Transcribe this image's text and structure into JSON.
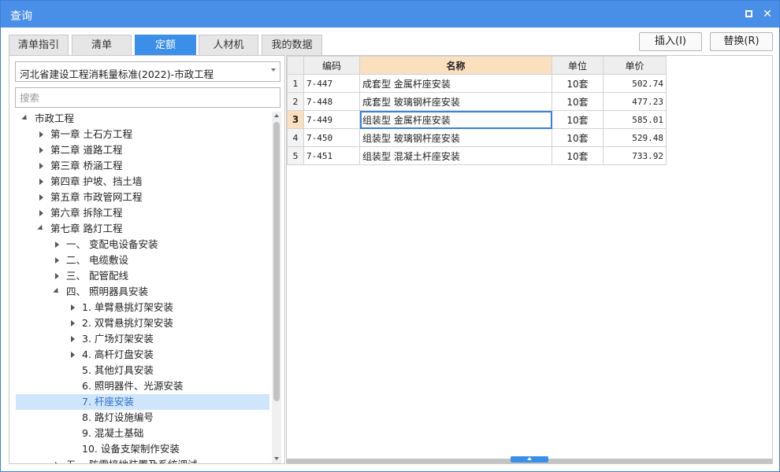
{
  "window": {
    "title": "查询"
  },
  "tabs": [
    {
      "label": "清单指引"
    },
    {
      "label": "清单"
    },
    {
      "label": "定额"
    },
    {
      "label": "人材机"
    },
    {
      "label": "我的数据"
    }
  ],
  "active_tab": "定额",
  "actions": {
    "insert": "插入(I)",
    "replace": "替换(R)"
  },
  "library_select": {
    "value": "河北省建设工程消耗量标准(2022)-市政工程"
  },
  "search": {
    "placeholder": "搜索"
  },
  "tree": [
    {
      "label": "市政工程",
      "level": 0,
      "state": "expanded"
    },
    {
      "label": "第一章 土石方工程",
      "level": 1,
      "state": "collapsed"
    },
    {
      "label": "第二章 道路工程",
      "level": 1,
      "state": "collapsed"
    },
    {
      "label": "第三章 桥涵工程",
      "level": 1,
      "state": "collapsed"
    },
    {
      "label": "第四章 护坡、挡土墙",
      "level": 1,
      "state": "collapsed"
    },
    {
      "label": "第五章 市政管网工程",
      "level": 1,
      "state": "collapsed"
    },
    {
      "label": "第六章 拆除工程",
      "level": 1,
      "state": "collapsed"
    },
    {
      "label": "第七章 路灯工程",
      "level": 1,
      "state": "expanded"
    },
    {
      "label": "一、 变配电设备安装",
      "level": 2,
      "state": "collapsed"
    },
    {
      "label": "二、 电缆敷设",
      "level": 2,
      "state": "collapsed"
    },
    {
      "label": "三、 配管配线",
      "level": 2,
      "state": "collapsed"
    },
    {
      "label": "四、 照明器具安装",
      "level": 2,
      "state": "expanded"
    },
    {
      "label": "1. 单臂悬挑灯架安装",
      "level": 3,
      "state": "collapsed"
    },
    {
      "label": "2. 双臂悬挑灯架安装",
      "level": 3,
      "state": "collapsed"
    },
    {
      "label": "3. 广场灯架安装",
      "level": 3,
      "state": "collapsed"
    },
    {
      "label": "4. 高杆灯盘安装",
      "level": 3,
      "state": "collapsed"
    },
    {
      "label": "5. 其他灯具安装",
      "level": 3,
      "state": "leaf"
    },
    {
      "label": "6. 照明器件、光源安装",
      "level": 3,
      "state": "leaf"
    },
    {
      "label": "7. 杆座安装",
      "level": 3,
      "state": "leaf",
      "selected": true
    },
    {
      "label": "8. 路灯设施编号",
      "level": 3,
      "state": "leaf"
    },
    {
      "label": "9. 混凝土基础",
      "level": 3,
      "state": "leaf"
    },
    {
      "label": "10. 设备支架制作安装",
      "level": 3,
      "state": "leaf"
    },
    {
      "label": "五、 防雷接地装置及系统调试",
      "level": 2,
      "state": "collapsed"
    }
  ],
  "table": {
    "columns": [
      "编码",
      "名称",
      "单位",
      "单价"
    ],
    "rows": [
      {
        "no": "1",
        "code": "7-447",
        "name": "成套型 金属杆座安装",
        "unit": "10套",
        "price": "502.74"
      },
      {
        "no": "2",
        "code": "7-448",
        "name": "成套型 玻璃钢杆座安装",
        "unit": "10套",
        "price": "477.23"
      },
      {
        "no": "3",
        "code": "7-449",
        "name": "组装型 金属杆座安装",
        "unit": "10套",
        "price": "585.01"
      },
      {
        "no": "4",
        "code": "7-450",
        "name": "组装型 玻璃钢杆座安装",
        "unit": "10套",
        "price": "529.48"
      },
      {
        "no": "5",
        "code": "7-451",
        "name": "组装型 混凝土杆座安装",
        "unit": "10套",
        "price": "733.92"
      }
    ],
    "current_row": "3"
  },
  "colors": {
    "titlebar": "#4a8fe7",
    "accent": "#3b8fe8",
    "selected_bg": "#cfe5fb",
    "header_highlight": "#fbe0c0"
  }
}
